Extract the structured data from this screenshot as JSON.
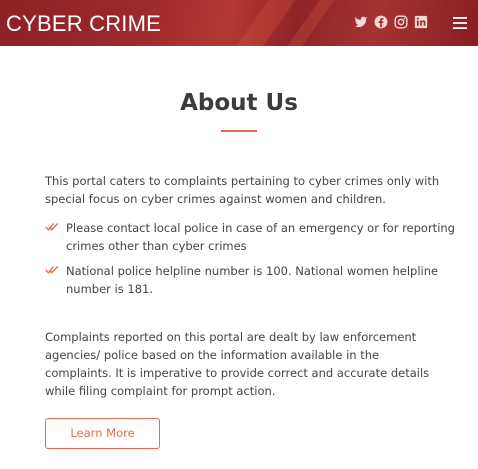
{
  "header": {
    "brand": "CYBER CRIME",
    "social_icons": [
      "twitter-icon",
      "facebook-icon",
      "instagram-icon",
      "linkedin-icon"
    ],
    "menu_icon": "hamburger-menu-icon"
  },
  "about": {
    "title": "About Us",
    "intro": "This portal caters to complaints pertaining to cyber crimes only with special focus on cyber crimes against women and children.",
    "points": [
      "Please contact local police in case of an emergency or for reporting crimes other than cyber crimes",
      "National police helpline number is 100. National women helpline number is 181."
    ],
    "paragraph": "Complaints reported on this portal are dealt by law enforcement agencies/ police based on the information available in the complaints. It is imperative to provide correct and accurate details while filing complaint for prompt action.",
    "button_label": "Learn More"
  },
  "colors": {
    "header_bg": "#9e2a2b",
    "accent": "#e96b4d",
    "text": "#444444",
    "title": "#3b3b3b"
  }
}
